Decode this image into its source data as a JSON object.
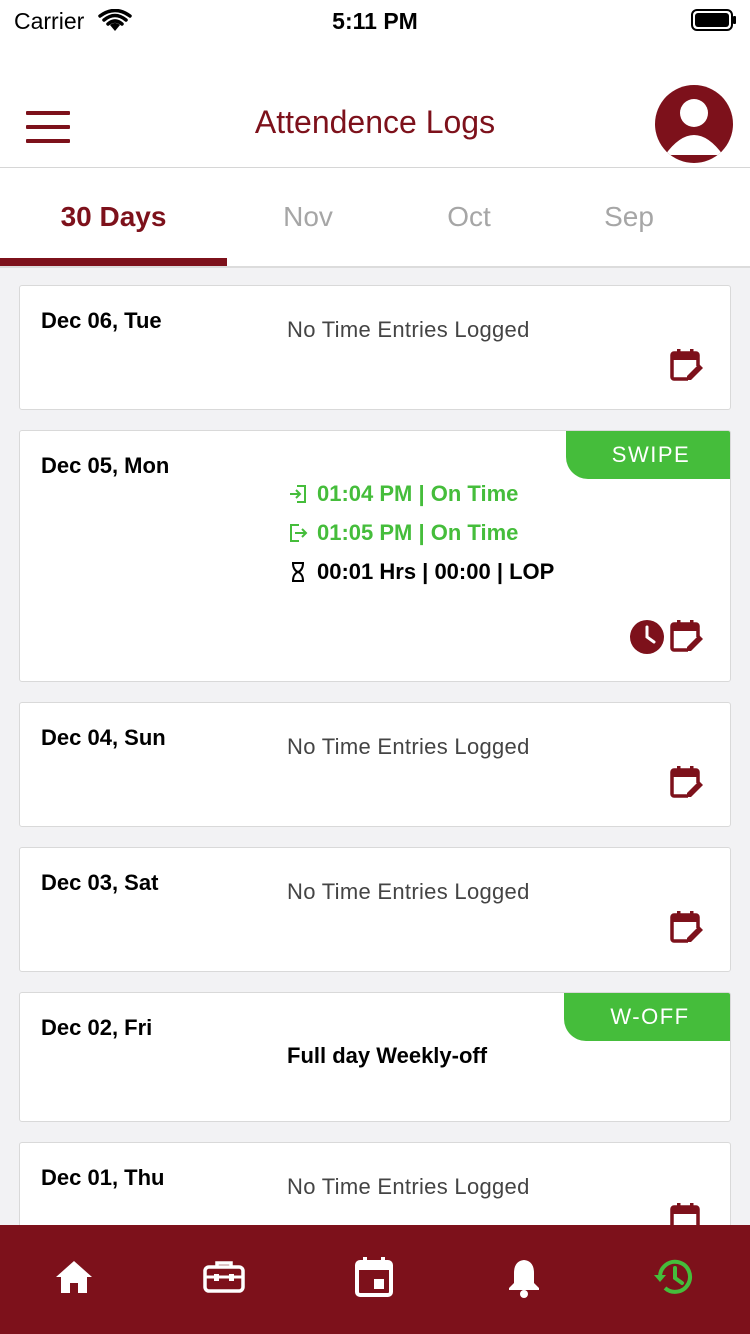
{
  "status_bar": {
    "carrier": "Carrier",
    "time": "5:11 PM"
  },
  "header": {
    "title": "Attendence Logs",
    "menu_icon": "hamburger-menu-icon",
    "avatar_icon": "user-avatar-icon"
  },
  "tabs": [
    {
      "label": "30 Days",
      "active": true
    },
    {
      "label": "Nov",
      "active": false
    },
    {
      "label": "Oct",
      "active": false
    },
    {
      "label": "Sep",
      "active": false
    }
  ],
  "entries": [
    {
      "date": "Dec 06, Tue",
      "message": "No Time Entries Logged"
    },
    {
      "date": "Dec 05, Mon",
      "tag": "SWIPE",
      "punch_in": "01:04 PM | On Time",
      "punch_out": "01:05 PM | On Time",
      "duration": "00:01 Hrs |  00:00  | LOP"
    },
    {
      "date": "Dec 04, Sun",
      "message": "No Time Entries Logged"
    },
    {
      "date": "Dec 03, Sat",
      "message": "No Time Entries Logged"
    },
    {
      "date": "Dec 02, Fri",
      "tag": "W-OFF",
      "message": "Full day Weekly-off"
    },
    {
      "date": "Dec 01, Thu",
      "message": "No Time Entries Logged"
    }
  ],
  "bottom_nav": [
    {
      "icon": "home-icon"
    },
    {
      "icon": "briefcase-icon"
    },
    {
      "icon": "calendar-icon"
    },
    {
      "icon": "bell-icon"
    },
    {
      "icon": "history-icon",
      "active": true
    }
  ],
  "colors": {
    "primary": "#7d111b",
    "success": "#45bd3b",
    "inactive_tab": "#a6a6a6",
    "background": "#f2f2f4"
  }
}
